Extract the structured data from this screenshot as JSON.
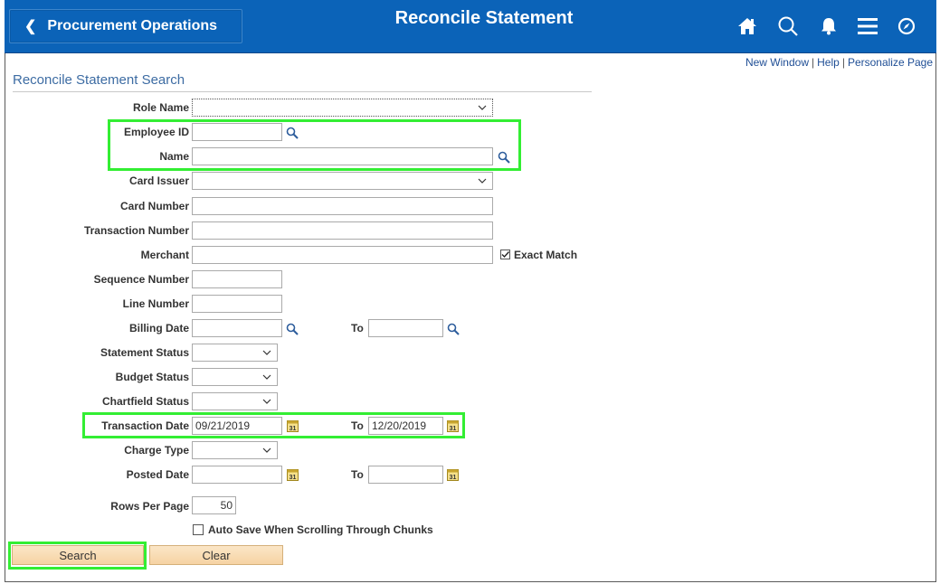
{
  "header": {
    "back_label": "Procurement Operations",
    "title": "Reconcile Statement",
    "icons": [
      "home-icon",
      "search-icon",
      "bell-icon",
      "menu-icon",
      "navbar-compass-icon"
    ]
  },
  "links": {
    "new_window": "New Window",
    "help": "Help",
    "personalize": "Personalize Page"
  },
  "form": {
    "section_title": "Reconcile Statement Search",
    "role_name": {
      "label": "Role Name",
      "value": ""
    },
    "employee_id": {
      "label": "Employee ID",
      "value": ""
    },
    "name": {
      "label": "Name",
      "value": ""
    },
    "card_issuer": {
      "label": "Card Issuer",
      "value": ""
    },
    "card_number": {
      "label": "Card Number",
      "value": ""
    },
    "transaction_number": {
      "label": "Transaction Number",
      "value": ""
    },
    "merchant": {
      "label": "Merchant",
      "value": "",
      "exact_match_label": "Exact Match",
      "exact_match_checked": true
    },
    "sequence_number": {
      "label": "Sequence Number",
      "value": ""
    },
    "line_number": {
      "label": "Line Number",
      "value": ""
    },
    "billing_date": {
      "label": "Billing Date",
      "value": "",
      "to_label": "To",
      "to_value": ""
    },
    "statement_status": {
      "label": "Statement Status",
      "value": ""
    },
    "budget_status": {
      "label": "Budget Status",
      "value": ""
    },
    "chartfield_status": {
      "label": "Chartfield Status",
      "value": ""
    },
    "transaction_date": {
      "label": "Transaction Date",
      "value": "09/21/2019",
      "to_label": "To",
      "to_value": "12/20/2019"
    },
    "charge_type": {
      "label": "Charge Type",
      "value": ""
    },
    "posted_date": {
      "label": "Posted Date",
      "value": "",
      "to_label": "To",
      "to_value": ""
    },
    "rows_per_page": {
      "label": "Rows Per Page",
      "value": "50"
    },
    "auto_save": {
      "label": "Auto Save When Scrolling Through Chunks",
      "checked": false
    }
  },
  "buttons": {
    "search": "Search",
    "clear": "Clear"
  },
  "colors": {
    "banner": "#0b63b8",
    "highlight": "#33ee33",
    "button": "#f6d3a3",
    "section_title": "#3d6ca3"
  }
}
